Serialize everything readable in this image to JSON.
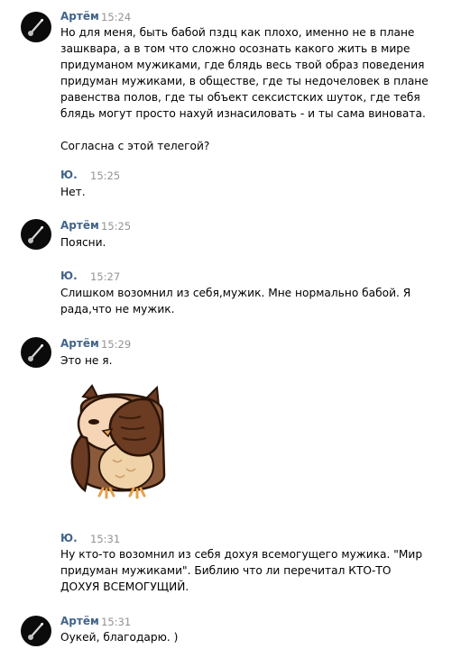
{
  "messages": [
    {
      "author": "Артём",
      "time": "15:24",
      "has_avatar": true,
      "lines": [
        "Но для меня, быть бабой пздц как плохо, именно не в плане",
        "зашквара, а в том что сложно осознать какого жить в мире",
        "придуманом мужиками, где блядь весь твой образ поведения",
        "придуман мужиками, в обществе, где ты недочеловек в плане",
        "равенства полов, где ты объект сексистских шуток, где тебя",
        "блядь могут просто нахуй изнасиловать - и ты сама виновата."
      ],
      "extra_line": "Согласна с этой телегой?"
    },
    {
      "author": "Ю.",
      "time": "15:25",
      "has_avatar": false,
      "lines": [
        "Нет."
      ]
    },
    {
      "author": "Артём",
      "time": "15:25",
      "has_avatar": true,
      "lines": [
        "Поясни."
      ]
    },
    {
      "author": "Ю.",
      "time": "15:27",
      "has_avatar": false,
      "lines": [
        "Слишком возомнил из себя,мужик. Мне нормально бабой. Я",
        "рада,что не мужик."
      ]
    },
    {
      "author": "Артём",
      "time": "15:29",
      "has_avatar": true,
      "lines": [
        "Это не я."
      ],
      "sticker": "facepalm-owl-sticker"
    },
    {
      "author": "Ю.",
      "time": "15:31",
      "has_avatar": false,
      "lines": [
        "Ну кто-то возомнил из себя дохуя всемогущего мужика. \"Мир",
        "придуман мужиками\". Библию что ли перечитал КТО-ТО",
        "ДОХУЯ ВСЕМОГУЩИЙ."
      ]
    },
    {
      "author": "Артём",
      "time": "15:31",
      "has_avatar": true,
      "lines": [
        "Оукей, благодарю. )"
      ]
    }
  ],
  "colors": {
    "author": "#42648b",
    "time": "#939393",
    "avatar_bg": "#0b0b0b"
  },
  "icons": {
    "avatar": "guitar-avatar-icon",
    "sticker": "facepalm-owl-sticker"
  }
}
